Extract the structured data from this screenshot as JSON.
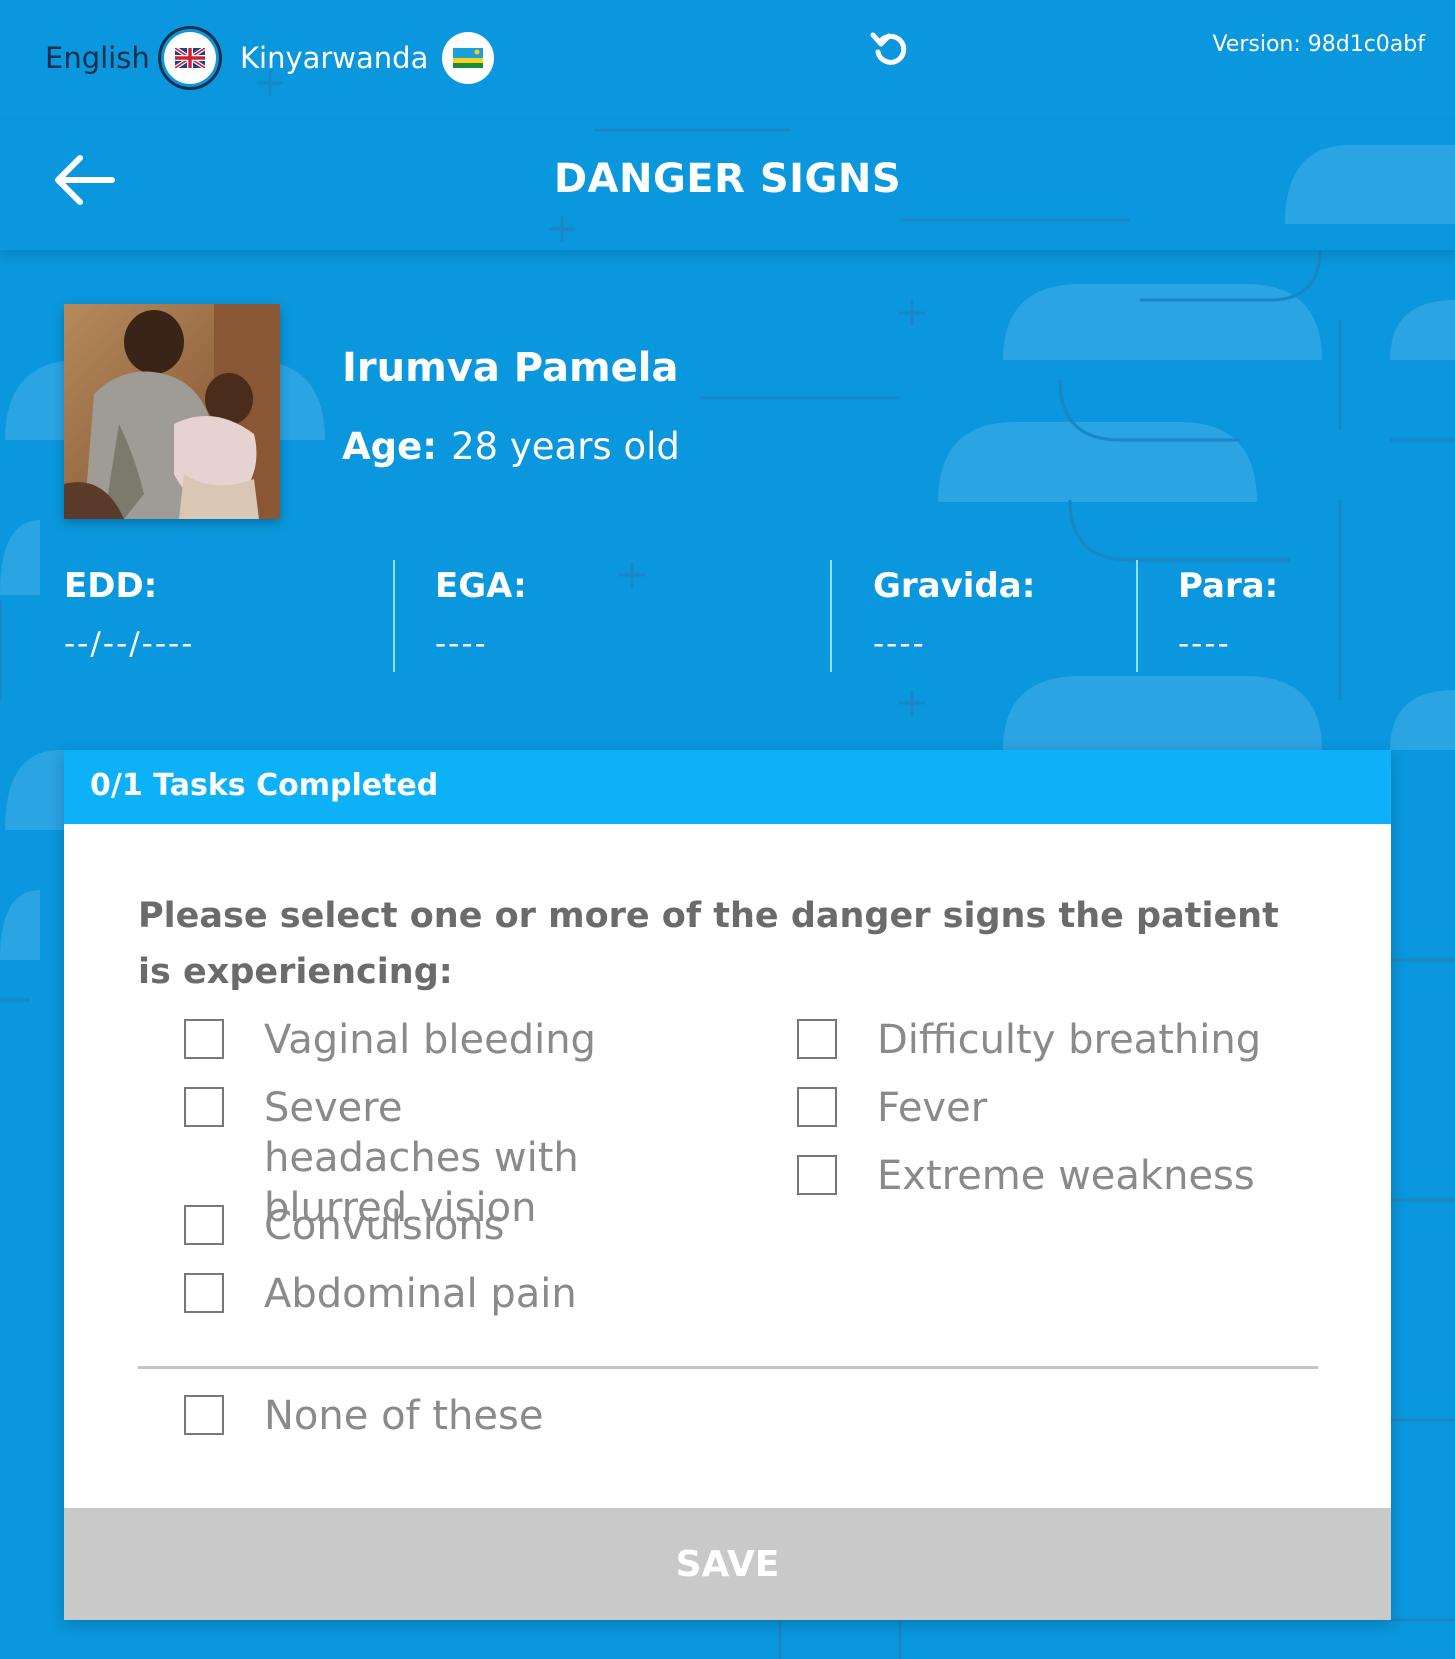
{
  "languages": [
    {
      "label": "English",
      "flag": "uk-flag-icon",
      "selected": true
    },
    {
      "label": "Kinyarwanda",
      "flag": "rwanda-flag-icon",
      "selected": false
    }
  ],
  "version": "Version: 98d1c0abf",
  "header": {
    "title": "DANGER SIGNS"
  },
  "patient": {
    "name": "Irumva Pamela",
    "age_label": "Age:",
    "age_value": "28 years old"
  },
  "stats": [
    {
      "label": "EDD:",
      "value": "--/--/----"
    },
    {
      "label": "EGA:",
      "value": "----"
    },
    {
      "label": "Gravida:",
      "value": "----"
    },
    {
      "label": "Para:",
      "value": "----"
    }
  ],
  "tasks": {
    "status": "0/1 Tasks Completed"
  },
  "form": {
    "question": "Please select one or more of the danger signs the patient is experiencing:",
    "options_left": [
      {
        "label": "Vaginal bleeding",
        "checked": false
      },
      {
        "label": "Severe headaches with blurred vision",
        "checked": false
      },
      {
        "label": "Convulsions",
        "checked": false
      },
      {
        "label": "Abdominal pain",
        "checked": false
      }
    ],
    "options_right": [
      {
        "label": "Difficulty breathing",
        "checked": false
      },
      {
        "label": "Fever",
        "checked": false
      },
      {
        "label": "Extreme weakness",
        "checked": false
      }
    ],
    "none_option": {
      "label": "None of these",
      "checked": false
    },
    "save_label": "SAVE"
  },
  "colors": {
    "background": "#0a97dd",
    "task_header": "#0db1f8",
    "save_disabled": "#c9c9c9",
    "text_dark": "#0f2f4d"
  }
}
